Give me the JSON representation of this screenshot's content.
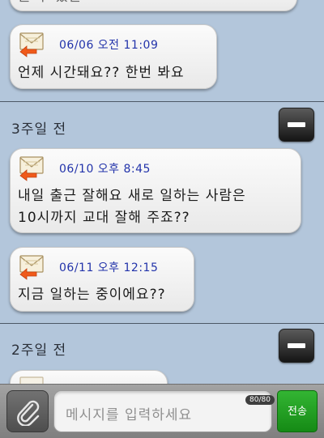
{
  "thread": {
    "top_partial_text": "늘 수 있는",
    "messages": [
      {
        "time": "06/06 오전 11:09",
        "lines": [
          "언제 시간돼요?? 한번 봐요"
        ]
      },
      {
        "time": "06/10 오후 8:45",
        "lines": [
          "내일 출근 잘해요 새로 일하는 사람은",
          "10시까지 교대 잘해 주죠??"
        ]
      },
      {
        "time": "06/11 오후 12:15",
        "lines": [
          "지금 일하는 중이에요??"
        ]
      }
    ],
    "sections": [
      {
        "label": "3주일 전"
      },
      {
        "label": "2주일 전"
      }
    ]
  },
  "composer": {
    "placeholder": "메시지를 입력하세요",
    "char_count": "80/80",
    "send_label": "전송"
  },
  "icons": {
    "message": "envelope-with-orange-arrow-icon",
    "collapse": "minus-icon",
    "attach": "paperclip-icon"
  },
  "colors": {
    "background": "#b3c6db",
    "timestamp": "#2233aa",
    "send_button": "#1e9e1e",
    "arrow": "#f05a1a"
  }
}
